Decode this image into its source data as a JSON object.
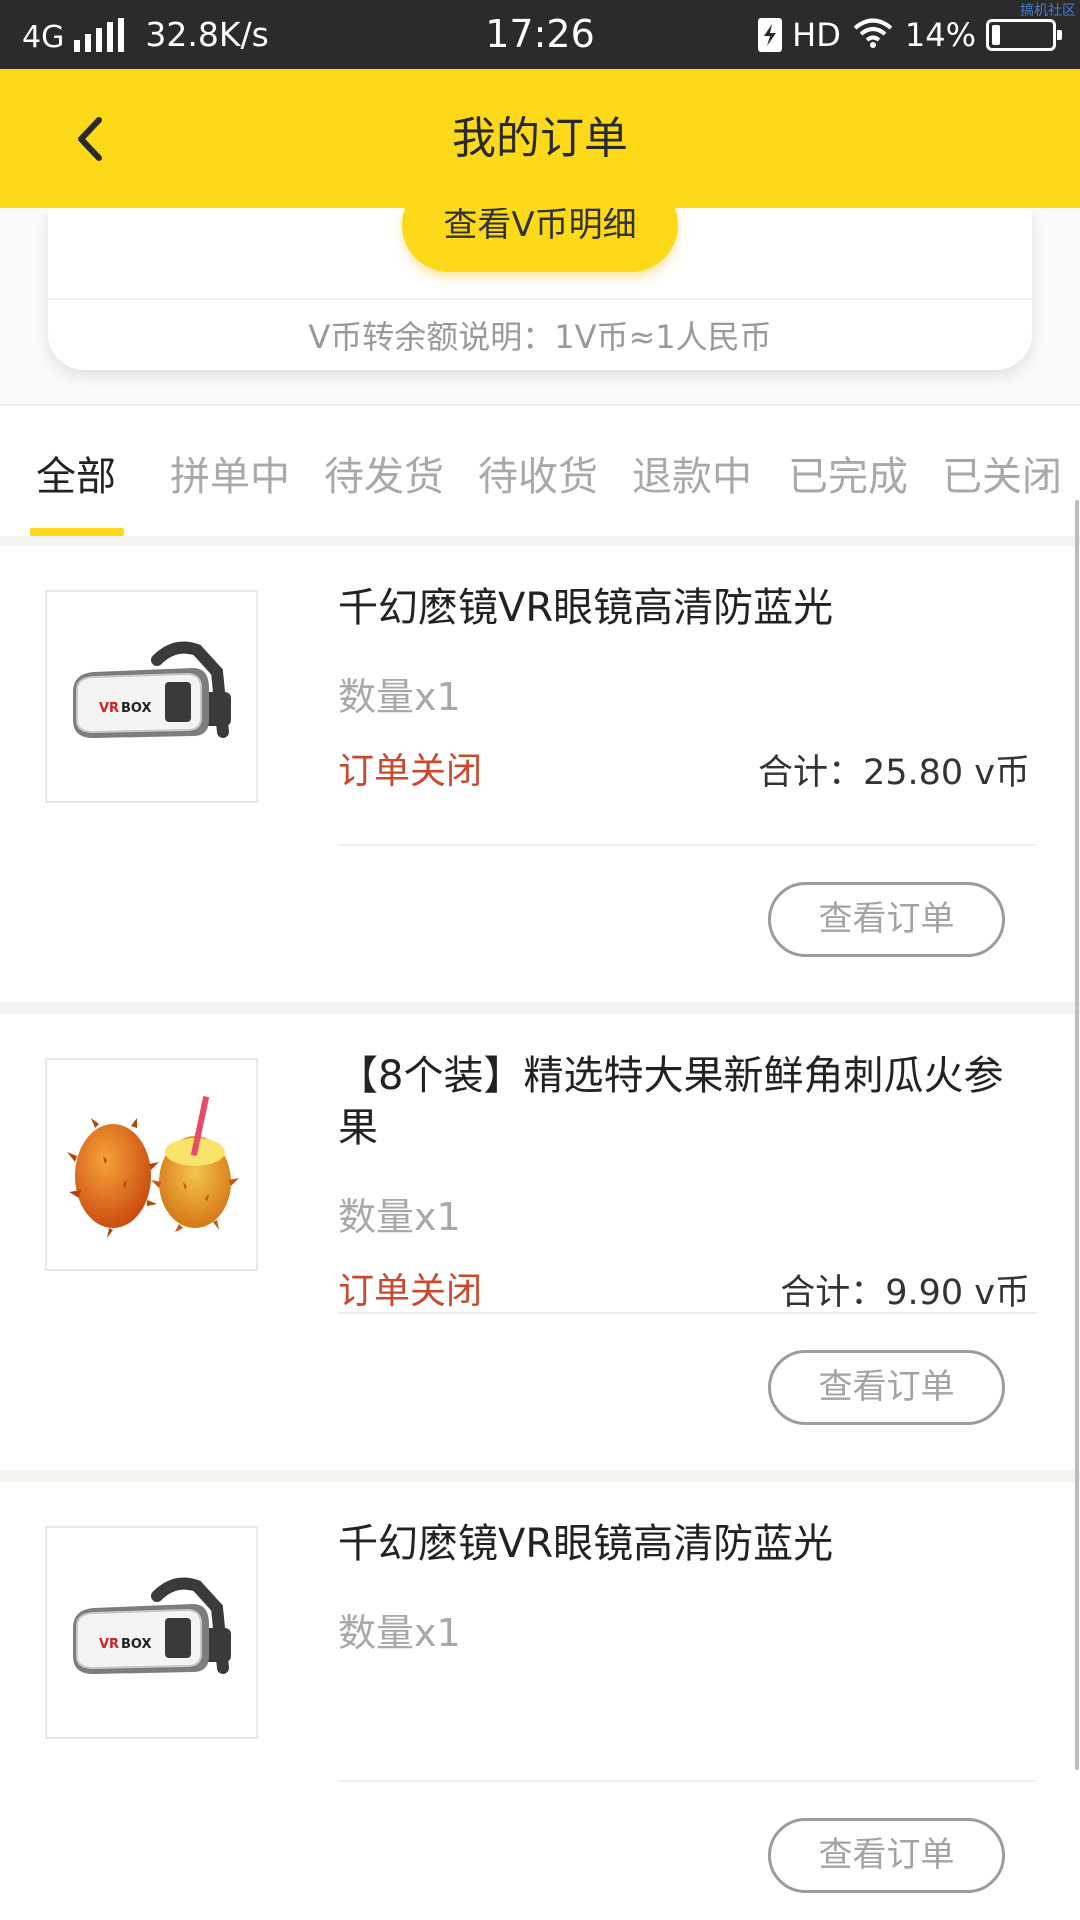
{
  "status_bar": {
    "network": "4G",
    "speed": "32.8K/s",
    "time": "17:26",
    "hd": "HD",
    "battery": "14%",
    "battery_level": 0.14,
    "watermark": "搞机社区"
  },
  "header": {
    "title": "我的订单",
    "back_icon": "chevron-left-icon",
    "background": "#fcd919"
  },
  "wallet": {
    "vcoin_button": "查看V币明细",
    "conversion_note": "V币转余额说明：1V币≈1人民币"
  },
  "tabs": [
    {
      "label": "全部",
      "active": true
    },
    {
      "label": "拼单中",
      "active": false
    },
    {
      "label": "待发货",
      "active": false
    },
    {
      "label": "待收货",
      "active": false
    },
    {
      "label": "退款中",
      "active": false
    },
    {
      "label": "已完成",
      "active": false
    },
    {
      "label": "已关闭",
      "active": false
    }
  ],
  "orders": [
    {
      "name": "千幻麽镜VR眼镜高清防蓝光",
      "quantity": "数量x1",
      "status": "订单关闭",
      "total": "合计：25.80 v币",
      "view_button": "查看订单",
      "image": "vr-headset-image"
    },
    {
      "name": "【8个装】精选特大果新鲜角刺瓜火参果",
      "quantity": "数量x1",
      "status": "订单关闭",
      "total": "合计：9.90 v币",
      "view_button": "查看订单",
      "image": "horned-melon-image"
    },
    {
      "name": "千幻麽镜VR眼镜高清防蓝光",
      "quantity": "数量x1",
      "view_button": "查看订单",
      "image": "vr-headset-image"
    }
  ],
  "colors": {
    "accent": "#fcd919",
    "status_closed": "#c8492c",
    "status_bar": "#2b2b2b"
  }
}
